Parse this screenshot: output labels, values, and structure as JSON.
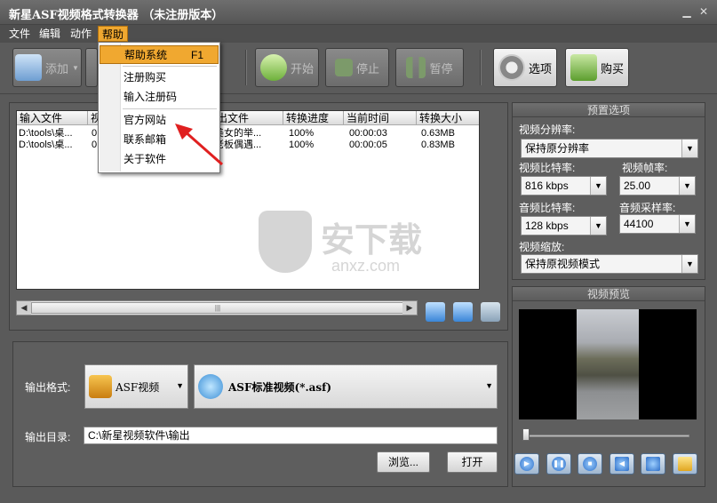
{
  "window": {
    "title": "新星ASF视频格式转换器 （未注册版本）"
  },
  "menubar": {
    "items": [
      "文件",
      "编辑",
      "动作",
      "帮助"
    ]
  },
  "toolbar": {
    "add_label": "添加",
    "start_label": "开始",
    "stop_label": "停止",
    "pause_label": "暂停",
    "options_label": "选项",
    "buy_label": "购买"
  },
  "help_menu": {
    "items": [
      {
        "label": "帮助系统",
        "shortcut": "F1"
      },
      {
        "label": "注册购买",
        "shortcut": ""
      },
      {
        "label": "输入注册码",
        "shortcut": ""
      },
      {
        "label": "官方网站",
        "shortcut": ""
      },
      {
        "label": "联系邮箱",
        "shortcut": ""
      },
      {
        "label": "关于软件",
        "shortcut": ""
      }
    ]
  },
  "filelist": {
    "columns": [
      "输入文件",
      "视",
      "",
      "",
      "出文件",
      "转换进度",
      "当前时间",
      "转换大小"
    ],
    "rows": [
      {
        "input": "D:\\tools\\桌...",
        "col2": "0",
        "output": "美女的举...",
        "progress": "100%",
        "time": "00:00:03",
        "size": "0.63MB"
      },
      {
        "input": "D:\\tools\\桌...",
        "col2": "0",
        "output": "老板偶遇...",
        "progress": "100%",
        "time": "00:00:05",
        "size": "0.83MB"
      }
    ]
  },
  "watermark": {
    "text": "安下载",
    "sub": "anxz.com"
  },
  "output": {
    "format_label": "输出格式:",
    "format_value": "ASF视频",
    "preset_value": "ASF标准视频(*.asf)",
    "dir_label": "输出目录:",
    "dir_value": "C:\\新星视频软件\\输出",
    "browse_label": "浏览...",
    "open_label": "打开"
  },
  "preset": {
    "title": "预置选项",
    "resolution_label": "视频分辨率:",
    "resolution_value": "保持原分辨率",
    "vbitrate_label": "视频比特率:",
    "vbitrate_value": "816 kbps",
    "framerate_label": "视频帧率:",
    "framerate_value": "25.00",
    "abitrate_label": "音频比特率:",
    "abitrate_value": "128 kbps",
    "samplerate_label": "音频采样率:",
    "samplerate_value": "44100",
    "zoom_label": "视频缩放:",
    "zoom_value": "保持原视频模式"
  },
  "preview": {
    "title": "视频预览"
  },
  "colors": {
    "menu_highlight": "#f0a830",
    "window_bg": "#5a5a5a"
  }
}
